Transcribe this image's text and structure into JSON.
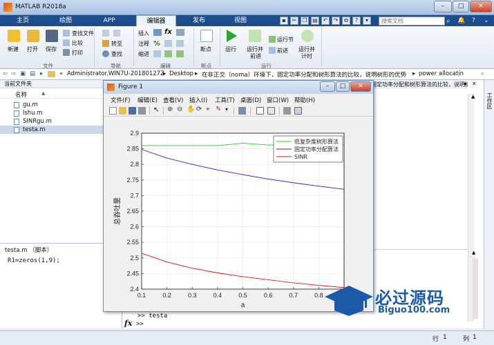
{
  "app": {
    "title": "MATLAB R2018a",
    "window_buttons": [
      "–",
      "□",
      "✕"
    ]
  },
  "tabs": [
    {
      "label": "主页",
      "active": false
    },
    {
      "label": "绘图",
      "active": false
    },
    {
      "label": "APP",
      "active": false
    },
    {
      "label": "编辑器",
      "active": true
    },
    {
      "label": "发布",
      "active": false
    },
    {
      "label": "视图",
      "active": false
    }
  ],
  "search": {
    "placeholder": "搜索文档"
  },
  "ribbon": {
    "new": "新建",
    "open": "打开",
    "save": "保存",
    "find_file": "查找文件",
    "compare": "比较",
    "print": "打印",
    "goto": "转至",
    "find": "查找",
    "insert": "插入",
    "comment": "注释",
    "indent": "缩进",
    "breakpoints": "断点",
    "run": "运行",
    "run_advance": [
      "运行并",
      "前进"
    ],
    "run_section": "运行节",
    "advance": "前进",
    "run_time": [
      "运行并",
      "计时"
    ],
    "sections": [
      "文件",
      "导航",
      "编辑",
      "断点",
      "运行"
    ]
  },
  "path": {
    "segments": [
      "«",
      "Administrator.WIN7U-20180127Z",
      "Desktop",
      "在非正交（noma）环境下，固定功率分配和树形算法的比较，说明树形的优势",
      "power allocatin"
    ]
  },
  "left_panel": {
    "title": "当前文件夹",
    "column": "名称",
    "sort": "▲",
    "files": [
      {
        "name": "gu.m",
        "selected": false
      },
      {
        "name": "lshu.m",
        "selected": false
      },
      {
        "name": "SINRgu.m",
        "selected": false
      },
      {
        "name": "testa.m",
        "selected": true
      }
    ],
    "detail_title": "testa.m （脚本）",
    "detail_code": "R1=zeros(1,9);"
  },
  "command": {
    "behind_title": "固定功率分配和树形算法的比较，说明树形的优...",
    "prompt_line": ">> testa",
    "fx": "fx",
    "prompt": ">>"
  },
  "status": {
    "row_label": "行",
    "row": "1",
    "col_label": "列",
    "col": "1"
  },
  "right_label": "工作区",
  "figure": {
    "title": "Figure 1",
    "menu": [
      "文件(F)",
      "编辑(E)",
      "查看(V)",
      "插入(I)",
      "工具(T)",
      "桌面(D)",
      "窗口(W)",
      "帮助(H)"
    ]
  },
  "watermark": {
    "line1": "必过源码",
    "line2": "Biguo100.com"
  },
  "colors": {
    "green": "#1fd21f",
    "blue": "#2020e0",
    "red": "#e01010",
    "tab_blue": "#1c4d8c"
  },
  "chart_data": {
    "type": "line",
    "xlabel": "a",
    "ylabel": "总吞吐量",
    "xlim": [
      0.1,
      0.9
    ],
    "ylim": [
      2.4,
      2.9
    ],
    "xticks": [
      0.1,
      0.2,
      0.3,
      0.4,
      0.5,
      0.6,
      0.7,
      0.8
    ],
    "yticks": [
      2.4,
      2.45,
      2.5,
      2.55,
      2.6,
      2.65,
      2.7,
      2.75,
      2.8,
      2.85,
      2.9
    ],
    "grid": true,
    "legend_position": "top-right",
    "series": [
      {
        "name": "低复杂度树形算法",
        "color": "#1fd21f",
        "x": [
          0.1,
          0.2,
          0.3,
          0.4,
          0.5,
          0.6,
          0.7,
          0.8,
          0.9
        ],
        "y": [
          2.86,
          2.86,
          2.86,
          2.86,
          2.868,
          2.862,
          2.862,
          2.862,
          2.862
        ]
      },
      {
        "name": "固定功率分配算法",
        "color": "#2020e0",
        "x": [
          0.1,
          0.2,
          0.3,
          0.4,
          0.5,
          0.6,
          0.7,
          0.8,
          0.9
        ],
        "y": [
          2.848,
          2.82,
          2.8,
          2.782,
          2.767,
          2.753,
          2.741,
          2.73,
          2.72
        ]
      },
      {
        "name": "SINR",
        "color": "#e01010",
        "x": [
          0.1,
          0.2,
          0.3,
          0.4,
          0.5,
          0.6,
          0.7,
          0.8,
          0.9
        ],
        "y": [
          2.515,
          2.487,
          2.467,
          2.452,
          2.44,
          2.43,
          2.42,
          2.412,
          2.405
        ]
      }
    ]
  }
}
